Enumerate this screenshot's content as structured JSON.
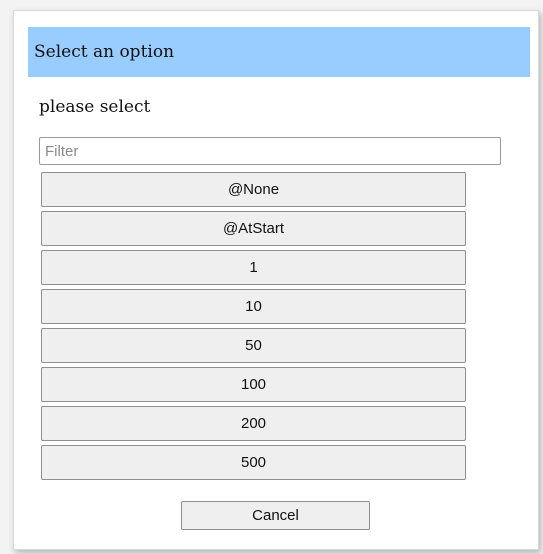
{
  "dialog": {
    "title": "Select an option",
    "prompt": "please select",
    "filter": {
      "placeholder": "Filter",
      "value": ""
    },
    "options": [
      "@None",
      "@AtStart",
      "1",
      "10",
      "50",
      "100",
      "200",
      "500"
    ],
    "cancel_label": "Cancel"
  },
  "colors": {
    "title_bar": "#99ccff",
    "button_bg": "#efefef",
    "button_border": "#8f8f8f"
  }
}
